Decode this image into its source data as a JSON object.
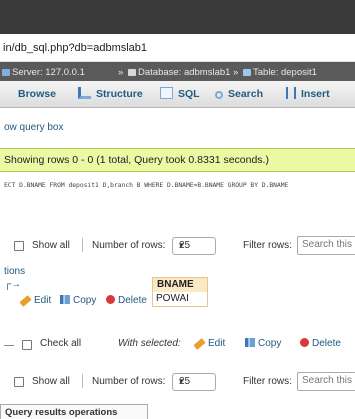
{
  "browser": {
    "url": "in/db_sql.php?db=adbmslab1"
  },
  "breadcrumb": {
    "server_label": "Server: 127.0.0.1",
    "sep1": "»",
    "database_label": "Database: adbmslab1",
    "sep2": "»",
    "table_label": "Table: deposit1"
  },
  "tabs": {
    "browse": "Browse",
    "structure": "Structure",
    "sql": "SQL",
    "search": "Search",
    "insert": "Insert"
  },
  "query_box_link": "ow query box",
  "success_message": "Showing rows 0 - 0 (1 total, Query took 0.8331 seconds.)",
  "sql_query": "ECT D.BNAME FROM deposit1 D,branch B WHERE D.BNAME=B.BNAME GROUP BY D.BNAME",
  "nav_top": {
    "show_all": "Show all",
    "number_of_rows_label": "Number of rows:",
    "rows_value": "25",
    "filter_label": "Filter rows:",
    "filter_placeholder": "Search this"
  },
  "options_link": "tions",
  "results": {
    "column": "BNAME",
    "rows": [
      {
        "bname": "POWAI"
      }
    ]
  },
  "row_actions": {
    "edit": "Edit",
    "copy": "Copy",
    "delete": "Delete"
  },
  "bulk": {
    "check_all": "Check all",
    "with_selected": "With selected:",
    "edit": "Edit",
    "copy": "Copy",
    "delete": "Delete"
  },
  "nav_bottom": {
    "show_all": "Show all",
    "number_of_rows_label": "Number of rows:",
    "rows_value": "25",
    "filter_label": "Filter rows:",
    "filter_placeholder": "Search this"
  },
  "query_results_operations": "Query results operations",
  "colors": {
    "success_bg": "#ebf8a4",
    "link": "#235a81",
    "header_bg": "#fbe8c5"
  }
}
